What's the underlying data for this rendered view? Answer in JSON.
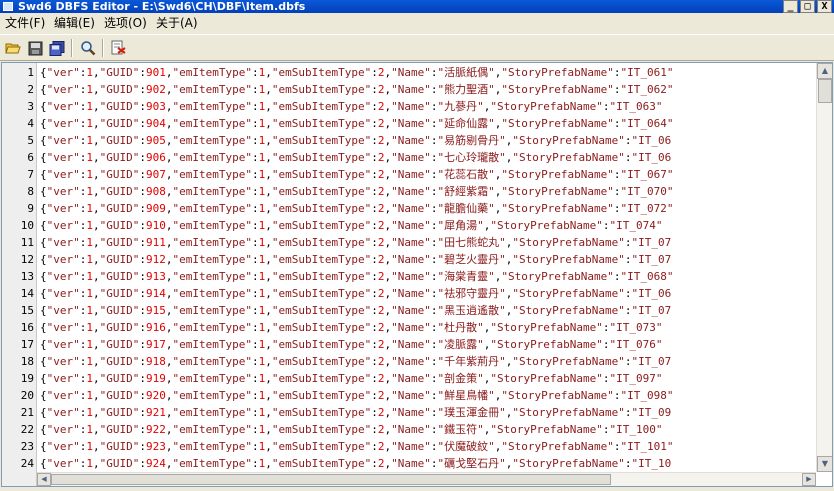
{
  "window": {
    "title": "Swd6 DBFS Editor - E:\\Swd6\\CH\\DBF\\Item.dbfs",
    "minimize_glyph": "_",
    "maximize_glyph": "□",
    "close_glyph": "X"
  },
  "menu": [
    {
      "label": "文件(F)"
    },
    {
      "label": "编辑(E)"
    },
    {
      "label": "选项(O)"
    },
    {
      "label": "关于(A)"
    }
  ],
  "toolbar": [
    {
      "name": "open-icon"
    },
    {
      "name": "save-icon"
    },
    {
      "name": "save-all-icon"
    },
    {
      "name": "find-icon"
    },
    {
      "name": "export-icon"
    }
  ],
  "editor": {
    "keys": {
      "ver": "\"ver\"",
      "guid": "\"GUID\"",
      "item_type": "\"emItemType\"",
      "sub_item_type": "\"emSubItemType\"",
      "name": "\"Name\"",
      "prefab": "\"StoryPrefabName\""
    },
    "lines": [
      {
        "no": "1",
        "ver": "1",
        "guid": "901",
        "item_type": "1",
        "sub_item_type": "2",
        "name": "\"活脈紙偶\"",
        "prefab": "\"IT_061\""
      },
      {
        "no": "2",
        "ver": "1",
        "guid": "902",
        "item_type": "1",
        "sub_item_type": "2",
        "name": "\"熊力聖酒\"",
        "prefab": "\"IT_062\""
      },
      {
        "no": "3",
        "ver": "1",
        "guid": "903",
        "item_type": "1",
        "sub_item_type": "2",
        "name": "\"九蔘丹\"",
        "prefab": "\"IT_063\""
      },
      {
        "no": "4",
        "ver": "1",
        "guid": "904",
        "item_type": "1",
        "sub_item_type": "2",
        "name": "\"延命仙露\"",
        "prefab": "\"IT_064\""
      },
      {
        "no": "5",
        "ver": "1",
        "guid": "905",
        "item_type": "1",
        "sub_item_type": "2",
        "name": "\"易筋剔骨丹\"",
        "prefab": "\"IT_06"
      },
      {
        "no": "6",
        "ver": "1",
        "guid": "906",
        "item_type": "1",
        "sub_item_type": "2",
        "name": "\"七心玲瓏散\"",
        "prefab": "\"IT_06"
      },
      {
        "no": "7",
        "ver": "1",
        "guid": "907",
        "item_type": "1",
        "sub_item_type": "2",
        "name": "\"花蕊石散\"",
        "prefab": "\"IT_067\""
      },
      {
        "no": "8",
        "ver": "1",
        "guid": "908",
        "item_type": "1",
        "sub_item_type": "2",
        "name": "\"舒經紫霜\"",
        "prefab": "\"IT_070\""
      },
      {
        "no": "9",
        "ver": "1",
        "guid": "909",
        "item_type": "1",
        "sub_item_type": "2",
        "name": "\"龍膽仙藥\"",
        "prefab": "\"IT_072\""
      },
      {
        "no": "10",
        "ver": "1",
        "guid": "910",
        "item_type": "1",
        "sub_item_type": "2",
        "name": "\"犀角湯\"",
        "prefab": "\"IT_074\""
      },
      {
        "no": "11",
        "ver": "1",
        "guid": "911",
        "item_type": "1",
        "sub_item_type": "2",
        "name": "\"田七熊蛇丸\"",
        "prefab": "\"IT_07"
      },
      {
        "no": "12",
        "ver": "1",
        "guid": "912",
        "item_type": "1",
        "sub_item_type": "2",
        "name": "\"碧芝火靈丹\"",
        "prefab": "\"IT_07"
      },
      {
        "no": "13",
        "ver": "1",
        "guid": "913",
        "item_type": "1",
        "sub_item_type": "2",
        "name": "\"海棠青靈\"",
        "prefab": "\"IT_068\""
      },
      {
        "no": "14",
        "ver": "1",
        "guid": "914",
        "item_type": "1",
        "sub_item_type": "2",
        "name": "\"祛邪守靈丹\"",
        "prefab": "\"IT_06"
      },
      {
        "no": "15",
        "ver": "1",
        "guid": "915",
        "item_type": "1",
        "sub_item_type": "2",
        "name": "\"黑玉逍遙散\"",
        "prefab": "\"IT_07"
      },
      {
        "no": "16",
        "ver": "1",
        "guid": "916",
        "item_type": "1",
        "sub_item_type": "2",
        "name": "\"杜丹散\"",
        "prefab": "\"IT_073\""
      },
      {
        "no": "17",
        "ver": "1",
        "guid": "917",
        "item_type": "1",
        "sub_item_type": "2",
        "name": "\"凌脈露\"",
        "prefab": "\"IT_076\""
      },
      {
        "no": "18",
        "ver": "1",
        "guid": "918",
        "item_type": "1",
        "sub_item_type": "2",
        "name": "\"千年紫荊丹\"",
        "prefab": "\"IT_07"
      },
      {
        "no": "19",
        "ver": "1",
        "guid": "919",
        "item_type": "1",
        "sub_item_type": "2",
        "name": "\"剖金策\"",
        "prefab": "\"IT_097\""
      },
      {
        "no": "20",
        "ver": "1",
        "guid": "920",
        "item_type": "1",
        "sub_item_type": "2",
        "name": "\"鮮星鳥幡\"",
        "prefab": "\"IT_098\""
      },
      {
        "no": "21",
        "ver": "1",
        "guid": "921",
        "item_type": "1",
        "sub_item_type": "2",
        "name": "\"璞玉渾金冊\"",
        "prefab": "\"IT_09"
      },
      {
        "no": "22",
        "ver": "1",
        "guid": "922",
        "item_type": "1",
        "sub_item_type": "2",
        "name": "\"鐵玉符\"",
        "prefab": "\"IT_100\""
      },
      {
        "no": "23",
        "ver": "1",
        "guid": "923",
        "item_type": "1",
        "sub_item_type": "2",
        "name": "\"伏魔破紋\"",
        "prefab": "\"IT_101\""
      },
      {
        "no": "24",
        "ver": "1",
        "guid": "924",
        "item_type": "1",
        "sub_item_type": "2",
        "name": "\"礪戈堅石丹\"",
        "prefab": "\"IT_10"
      }
    ]
  }
}
